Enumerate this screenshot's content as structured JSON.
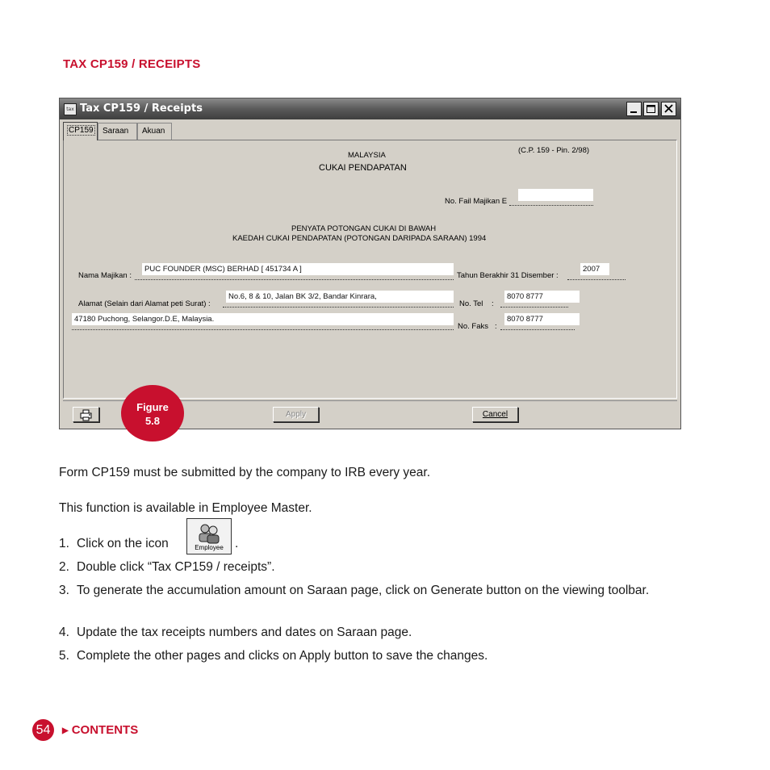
{
  "section_title": "TAX CP159 / RECEIPTS",
  "window": {
    "title": "Tax CP159 / Receipts",
    "icon_text": "tax",
    "tabs": [
      {
        "label": "CP159"
      },
      {
        "label": "Saraan"
      },
      {
        "label": "Akuan"
      }
    ],
    "form": {
      "country": "MALAYSIA",
      "heading": "CUKAI PENDAPATAN",
      "form_ref": "(C.P. 159 - Pin. 2/98)",
      "file_no_label": "No. Fail Majikan E",
      "file_no_value": "",
      "statement_line1": "PENYATA POTONGAN CUKAI DI BAWAH",
      "statement_line2": "KAEDAH CUKAI PENDAPATAN (POTONGAN DARIPADA SARAAN) 1994",
      "employer_label": "Nama Majikan :",
      "employer_value": "PUC FOUNDER (MSC) BERHAD [ 451734 A ]",
      "year_label": "Tahun Berakhir 31 Disember :",
      "year_value": "2007",
      "address_label": "Alamat (Selain dari Alamat peti Surat) :",
      "address_line1": "No.6, 8 & 10, Jalan BK 3/2, Bandar Kinrara,",
      "address_line2": "47180 Puchong, Selangor.D.E, Malaysia.",
      "tel_label": "No. Tel",
      "tel_value": "8070 8777",
      "fax_label": "No. Faks",
      "fax_value": "8070 8777"
    },
    "buttons": {
      "apply": "Apply",
      "cancel": "Cancel"
    }
  },
  "figure_badge": {
    "line1": "Figure",
    "line2": "5.8"
  },
  "body": {
    "para1": "Form CP159 must be submitted by the company to IRB every year.",
    "para2": "This function is available in Employee Master.",
    "steps": [
      {
        "num": "1.",
        "text": "Click on the icon",
        "suffix": "."
      },
      {
        "num": "2.",
        "text": "Double click “Tax CP159 / receipts”."
      },
      {
        "num": "3.",
        "text": "To generate the accumulation amount on Saraan page, click on Generate button on the viewing toolbar."
      },
      {
        "num": "4.",
        "text": "Update the tax receipts numbers and dates on Saraan page."
      },
      {
        "num": "5.",
        "text": "Complete the other pages and clicks on Apply button to save the changes."
      }
    ],
    "employee_icon_label": "Employee"
  },
  "footer": {
    "page_number": "54",
    "contents_label": "CONTENTS"
  },
  "colors": {
    "accent": "#c8102e"
  }
}
